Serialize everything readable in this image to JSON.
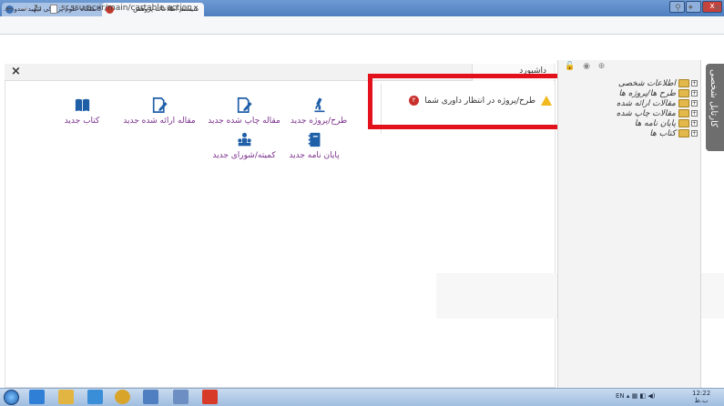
{
  "browser": {
    "tabs": [
      {
        "label": "دانشگاه علوم پزشکی شهید صدوق..."
      },
      {
        "label": "سیستم اطلاعات پژوهش"
      }
    ],
    "url": "sr.ssu.ac.ir/main/cartable.action",
    "window_controls": {
      "close": "x"
    }
  },
  "main": {
    "close_label": "×",
    "dashboard_tab": "داشبورد",
    "pending_text": "طرح/پروژه در انتظار داوری شما",
    "pending_count": "۲",
    "shortcuts": [
      {
        "id": "book",
        "label": "کتاب جدید",
        "icon": "book-icon"
      },
      {
        "id": "presented",
        "label": "مقاله ارائه شده جدید",
        "icon": "edit-document-icon"
      },
      {
        "id": "published",
        "label": "مقاله چاپ شده جدید",
        "icon": "edit-document-icon"
      },
      {
        "id": "project",
        "label": "طرح/پروژه جدید",
        "icon": "microscope-icon"
      },
      {
        "id": "committee",
        "label": "کمیته/شورای جدید",
        "icon": "committee-icon"
      },
      {
        "id": "thesis",
        "label": "پایان نامه جدید",
        "icon": "notebook-icon"
      }
    ]
  },
  "sidebar": {
    "tab_label": "کارتابل شخصی",
    "items": [
      {
        "label": "اطلاعات شخصی"
      },
      {
        "label": "طرح ها/پروژه ها"
      },
      {
        "label": "مقالات ارائه شده"
      },
      {
        "label": "مقالات چاپ شده"
      },
      {
        "label": "پایان نامه ها"
      },
      {
        "label": "کتاب ها"
      }
    ]
  },
  "taskbar": {
    "language": "EN",
    "time": "12:22",
    "date": "ب.ظ"
  },
  "colors": {
    "accent_purple": "#7a2e8c",
    "highlight_red": "#e3111b",
    "badge_red": "#c9302c",
    "warning_yellow": "#f0b91e"
  }
}
